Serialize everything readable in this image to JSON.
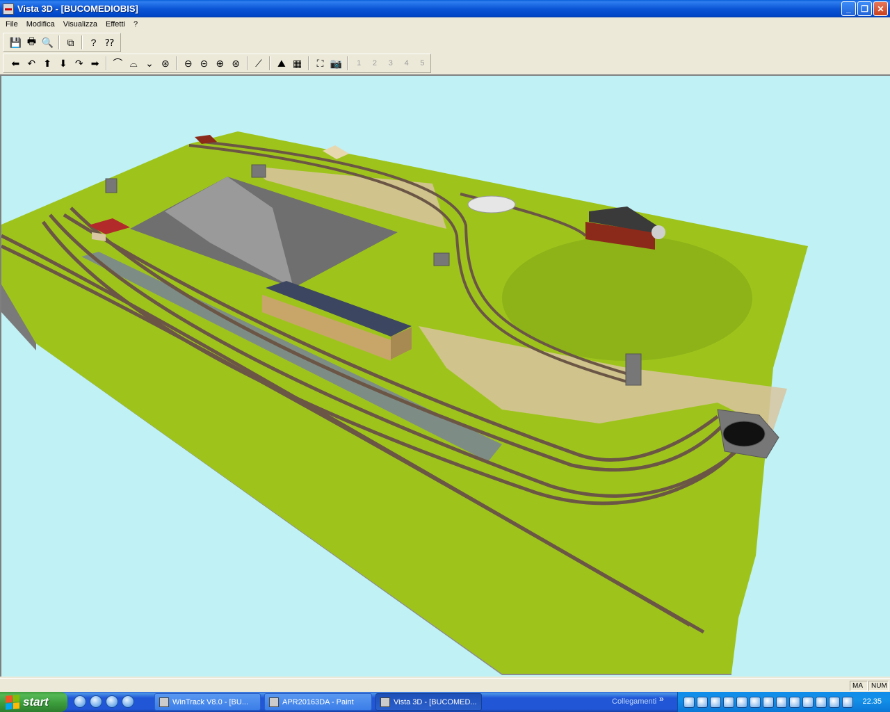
{
  "window": {
    "title": "Vista 3D - [BUCOMEDIOBIS]",
    "controls": {
      "minimize": "_",
      "maximize": "❐",
      "close": "✕"
    }
  },
  "menu": [
    "File",
    "Modifica",
    "Visualizza",
    "Effetti",
    "?"
  ],
  "toolbar1": [
    {
      "name": "save-icon",
      "glyph": "💾"
    },
    {
      "name": "print-icon",
      "glyph": "🖶"
    },
    {
      "name": "print-preview-icon",
      "glyph": "🔍"
    },
    {
      "name": "copy-icon",
      "glyph": "⧉"
    },
    {
      "name": "help-icon",
      "glyph": "?"
    },
    {
      "name": "context-help-icon",
      "glyph": "⁇"
    }
  ],
  "toolbar2": {
    "navigation": [
      {
        "name": "move-left-icon",
        "glyph": "⬅"
      },
      {
        "name": "rotate-left-icon",
        "glyph": "↶"
      },
      {
        "name": "move-up-icon",
        "glyph": "⬆"
      },
      {
        "name": "move-down-icon",
        "glyph": "⬇"
      },
      {
        "name": "rotate-right-icon",
        "glyph": "↷"
      },
      {
        "name": "move-right-icon",
        "glyph": "➡"
      }
    ],
    "camera": [
      {
        "name": "tilt-up-icon",
        "glyph": "⌒"
      },
      {
        "name": "tilt-down-icon",
        "glyph": "⌓"
      },
      {
        "name": "pan-down-icon",
        "glyph": "⌄"
      },
      {
        "name": "orbit-icon",
        "glyph": "⊛"
      }
    ],
    "zoom": [
      {
        "name": "zoom-out-small-icon",
        "glyph": "⊖"
      },
      {
        "name": "zoom-out-icon",
        "glyph": "⊝"
      },
      {
        "name": "zoom-in-icon",
        "glyph": "⊕"
      },
      {
        "name": "zoom-in-large-icon",
        "glyph": "⊛"
      }
    ],
    "scene": [
      {
        "name": "track-icon",
        "glyph": "⟋"
      },
      {
        "name": "terrain-icon",
        "glyph": "⛰"
      },
      {
        "name": "grid-icon",
        "glyph": "▦"
      }
    ],
    "view": [
      {
        "name": "fit-view-icon",
        "glyph": "⛶"
      },
      {
        "name": "snapshot-icon",
        "glyph": "📷"
      }
    ],
    "presets": [
      "1",
      "2",
      "3",
      "4",
      "5"
    ]
  },
  "statusbar": {
    "caps": "MA",
    "num": "NUM"
  },
  "taskbar": {
    "start": "start",
    "tasks": [
      {
        "label": "WinTrack  V8.0 - [BU...",
        "active": false
      },
      {
        "label": "APR20163DA - Paint",
        "active": false
      },
      {
        "label": "Vista 3D - [BUCOMED...",
        "active": true
      }
    ],
    "links_label": "Collegamenti",
    "chevron": "»",
    "clock": "22.35"
  },
  "scene_colors": {
    "sky": "#bff1f5",
    "grass": "#9ec41c",
    "base": "#8a8a8a",
    "track": "#6e5a48",
    "pit": "#7a7a7a",
    "rock": "#d9c6a8"
  }
}
